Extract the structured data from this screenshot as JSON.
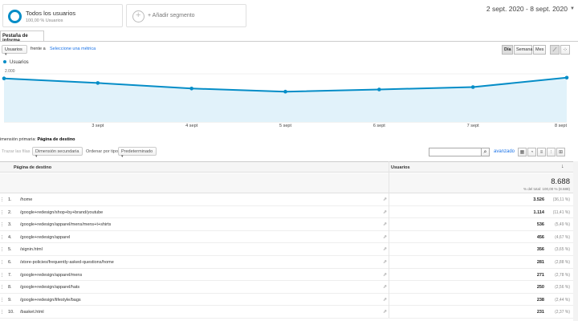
{
  "segments": [
    {
      "title": "Todos los usuarios",
      "subtitle": "100,00 % Usuarios"
    },
    {
      "title": "+ Añadir segmento"
    }
  ],
  "date_range": "2 sept. 2020 - 8 sept. 2020",
  "tab": "Pestaña de informe",
  "metric_select": "Usuarios",
  "vs_label": "frente a",
  "select_metric_link": "Seleccione una métrica",
  "granularity": [
    "Día",
    "Semana",
    "Mes"
  ],
  "legend_label": "Usuarios",
  "chart_data": {
    "type": "area",
    "x": [
      "2 sept",
      "3 sept",
      "4 sept",
      "5 sept",
      "6 sept",
      "7 sept",
      "8 sept"
    ],
    "x_tick_labels": [
      "3 sept",
      "4 sept",
      "5 sept",
      "6 sept",
      "7 sept",
      "8 sept"
    ],
    "series": [
      {
        "name": "Usuarios",
        "values": [
          1810,
          1620,
          1390,
          1260,
          1350,
          1450,
          1840
        ]
      }
    ],
    "y_tick_labels": [
      "2.000",
      "1.000"
    ],
    "y_ticks": [
      2000,
      1000
    ],
    "ylim": [
      0,
      2300
    ],
    "grid": true,
    "color": "#058dc7",
    "fill": "#e1f2fa"
  },
  "primary_dimension": {
    "label": "imensión primaria:",
    "value": "Página de destino"
  },
  "toolbar": {
    "plot_rows": "Trazar las filas",
    "secondary_dimension": "Dimensión secundaria",
    "sort_label": "Ordenar por tipo:",
    "sort_value": "Predeterminado",
    "advanced": "avanzado"
  },
  "table": {
    "col_page": "Página de destino",
    "col_users": "Usuarios",
    "total": "8.688",
    "total_sub": "% del total: 100,00 % (8.688)",
    "rows": [
      {
        "num": "1.",
        "page": "/home",
        "value": "3.526",
        "pct": "(36,11 %)"
      },
      {
        "num": "2.",
        "page": "/google+redesign/shop+by+brand/youtube",
        "value": "1.114",
        "pct": "(11,41 %)"
      },
      {
        "num": "3.",
        "page": "/google+redesign/apparel/mens/mens+t+shirts",
        "value": "536",
        "pct": "(5,49 %)"
      },
      {
        "num": "4.",
        "page": "/google+redesign/apparel",
        "value": "456",
        "pct": "(4,67 %)"
      },
      {
        "num": "5.",
        "page": "/signin.html",
        "value": "356",
        "pct": "(3,65 %)"
      },
      {
        "num": "6.",
        "page": "/store-policies/frequently-asked-questions/home",
        "value": "281",
        "pct": "(2,88 %)"
      },
      {
        "num": "7.",
        "page": "/google+redesign/apparel/mens",
        "value": "271",
        "pct": "(2,78 %)"
      },
      {
        "num": "8.",
        "page": "/google+redesign/apparel/hats",
        "value": "250",
        "pct": "(2,56 %)"
      },
      {
        "num": "9.",
        "page": "/google+redesign/lifestyle/bags",
        "value": "238",
        "pct": "(2,44 %)"
      },
      {
        "num": "10.",
        "page": "/basket.html",
        "value": "231",
        "pct": "(2,37 %)"
      }
    ]
  }
}
